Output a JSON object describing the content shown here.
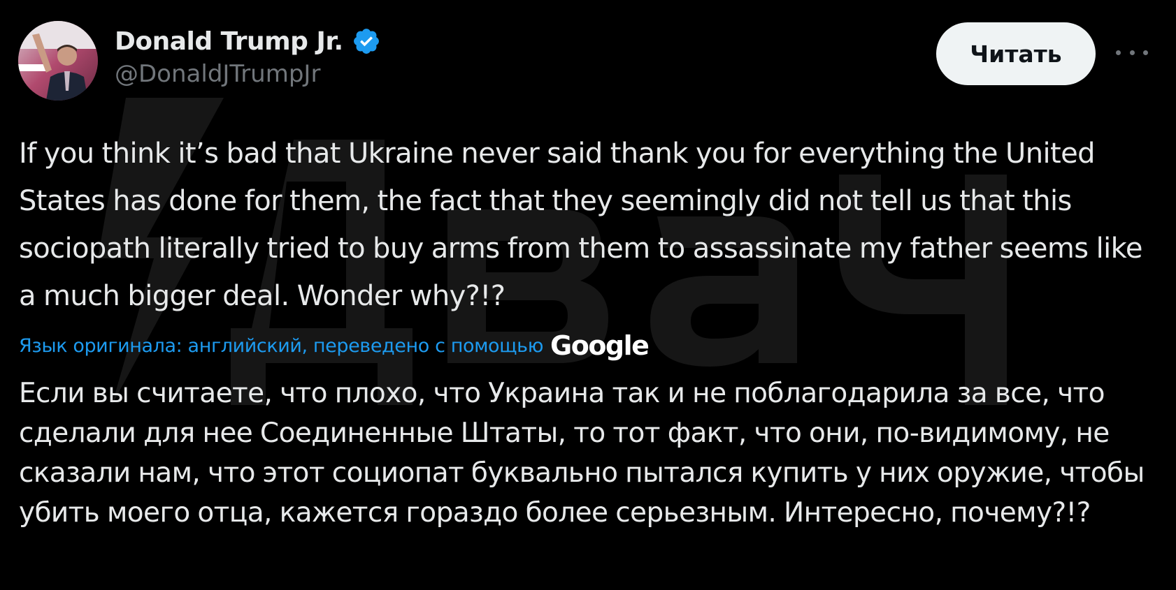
{
  "author": {
    "display_name": "Donald Trump Jr.",
    "handle": "@DonaldJTrumpJr",
    "verified": true,
    "verified_color": "#1d9bf0"
  },
  "actions": {
    "follow_label": "Читать",
    "more_icon": "more-horizontal-icon"
  },
  "tweet": {
    "text": "If you think it’s bad that Ukraine never said thank you for everything the United States has done for them, the fact that they seemingly did not tell us that this sociopath literally tried to buy arms from them to assassinate my father seems like a much bigger deal. Wonder why?!?"
  },
  "translation": {
    "label": "Язык оригинала: английский, переведено с помощью",
    "provider": "Google",
    "label_color": "#1d9bf0",
    "text": "Если вы считаете, что плохо, что Украина так и не поблагодарила за все, что сделали для нее Соединенные Штаты, то тот факт, что они, по-видимому, не сказали нам, что этот социопат буквально пытался купить у них оружие, чтобы убить моего отца, кажется гораздо более серьезным. Интересно, почему?!?"
  },
  "watermark": {
    "icon": "watermark-logo-icon"
  }
}
